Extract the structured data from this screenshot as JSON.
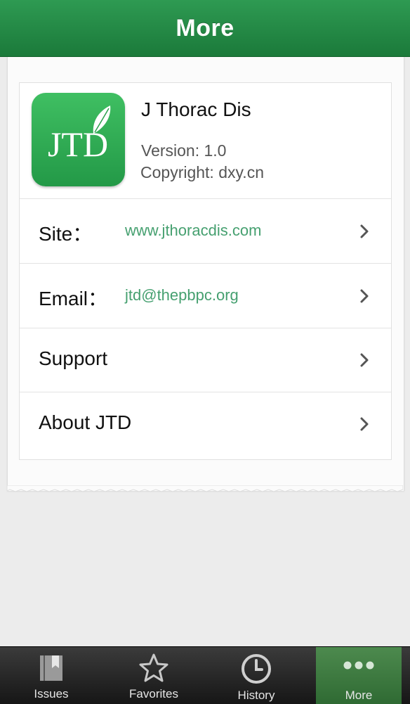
{
  "nav": {
    "title": "More"
  },
  "app": {
    "logo_text": "JTD",
    "name": "J Thorac Dis",
    "version": "Version: 1.0",
    "copyright": "Copyright: dxy.cn"
  },
  "rows": [
    {
      "label": "Site：",
      "value": "www.jthoracdis.com"
    },
    {
      "label": "Email：",
      "value": "jtd@thepbpc.org"
    },
    {
      "label": "Support",
      "value": ""
    },
    {
      "label": "About JTD",
      "value": ""
    }
  ],
  "tabs": [
    {
      "label": "Issues",
      "icon": "issues-icon"
    },
    {
      "label": "Favorites",
      "icon": "star-icon"
    },
    {
      "label": "History",
      "icon": "clock-icon"
    },
    {
      "label": "More",
      "icon": "more-dots-icon",
      "active": true
    }
  ],
  "colors": {
    "nav_green": "#1b7a3a",
    "link_green": "#46a070",
    "tab_active": "#3c7a3f"
  }
}
